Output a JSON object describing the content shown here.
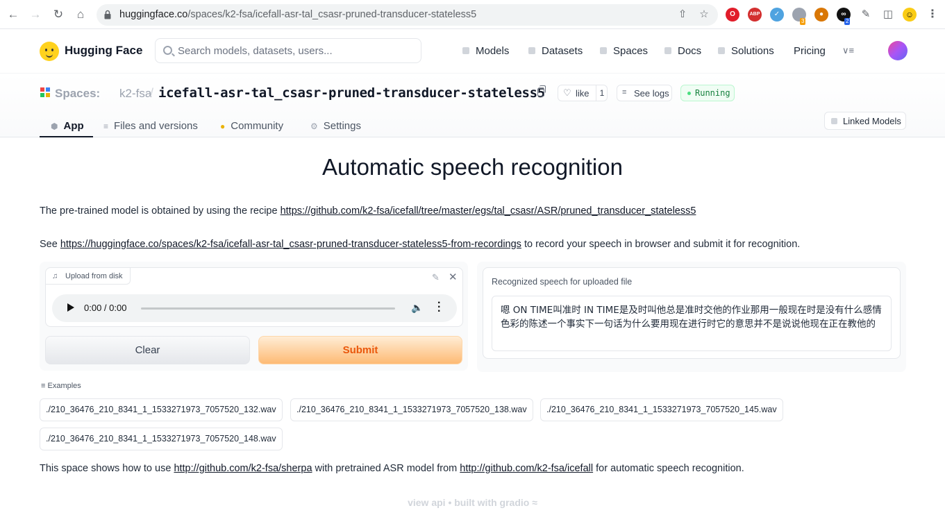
{
  "browser": {
    "url_host": "huggingface.co",
    "url_path": "/spaces/k2-fsa/icefall-asr-tal_csasr-pruned-transducer-stateless5",
    "extension_badges": [
      "3",
      "2"
    ]
  },
  "hf_header": {
    "brand": "Hugging Face",
    "search_placeholder": "Search models, datasets, users...",
    "nav": [
      "Models",
      "Datasets",
      "Spaces",
      "Docs",
      "Solutions",
      "Pricing"
    ],
    "more": "∨≡"
  },
  "space": {
    "label": "Spaces:",
    "owner": "k2-fsa",
    "separator": "/",
    "name": "icefall-asr-tal_csasr-pruned-transducer-stateless5",
    "like_label": "like",
    "like_count": "1",
    "logs_label": "See logs",
    "status": "Running",
    "status_color": "#22c55e",
    "tabs": [
      "App",
      "Files and versions",
      "Community",
      "Settings"
    ],
    "linked_models": "Linked Models"
  },
  "app": {
    "title": "Automatic speech recognition",
    "para1_prefix": "The pre-trained model is obtained by using the recipe ",
    "para1_link": "https://github.com/k2-fsa/icefall/tree/master/egs/tal_csasr/ASR/pruned_transducer_stateless5",
    "para2_prefix": "See ",
    "para2_link": "https://huggingface.co/spaces/k2-fsa/icefall-asr-tal_csasr-pruned-transducer-stateless5-from-recordings",
    "para2_suffix": " to record your speech in browser and submit it for recognition.",
    "upload_label": "Upload from disk",
    "player_time": "0:00 / 0:00",
    "clear_label": "Clear",
    "submit_label": "Submit",
    "output_label": "Recognized speech for uploaded file",
    "output_text": "嗯 ON TIME叫准时 IN TIME是及时叫他总是准时交他的作业那用一般现在时是没有什么感情色彩的陈述一个事实下一句话为什么要用现在进行时它的意思并不是说说他现在正在教他的",
    "examples_label": "Examples",
    "examples": [
      "./210_36476_210_8341_1_1533271973_7057520_132.wav",
      "./210_36476_210_8341_1_1533271973_7057520_138.wav",
      "./210_36476_210_8341_1_1533271973_7057520_145.wav",
      "./210_36476_210_8341_1_1533271973_7057520_148.wav"
    ],
    "para3_prefix": "This space shows how to use ",
    "para3_link1": "http://github.com/k2-fsa/sherpa",
    "para3_middle": " with pretrained ASR model from ",
    "para3_link2": "http://github.com/k2-fsa/icefall",
    "para3_suffix": " for automatic speech recognition."
  },
  "footer": {
    "view_api": "view api",
    "dot": "•",
    "built_with": "built with gradio"
  }
}
